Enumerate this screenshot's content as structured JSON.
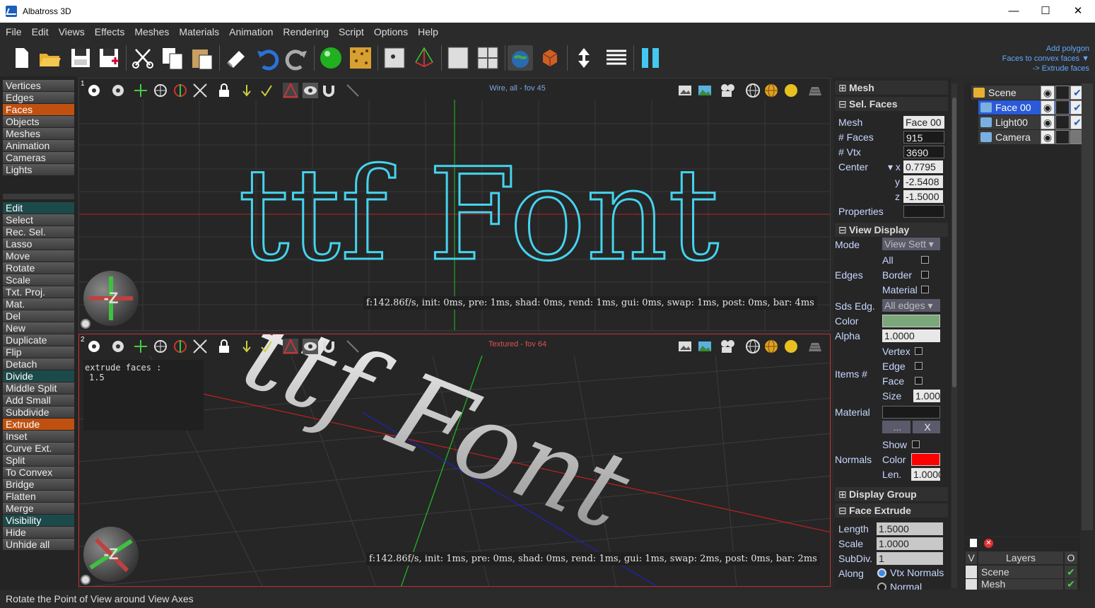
{
  "window": {
    "title": "Albatross 3D",
    "minimize": "—",
    "maximize": "☐",
    "close": "✕"
  },
  "menu": [
    "File",
    "Edit",
    "Views",
    "Effects",
    "Meshes",
    "Materials",
    "Animation",
    "Rendering",
    "Script",
    "Options",
    "Help"
  ],
  "hint": {
    "line1": "Add polygon",
    "line2": "Faces to convex faces ▼",
    "line3": "-> Extrude faces"
  },
  "modes": [
    "Vertices",
    "Edges",
    "Faces",
    "Objects",
    "Meshes",
    "Animation",
    "Cameras",
    "Lights"
  ],
  "selected_mode": "Faces",
  "tools": [
    {
      "label": "Edit",
      "kind": "head"
    },
    {
      "label": "Select"
    },
    {
      "label": "Rec. Sel."
    },
    {
      "label": "Lasso"
    },
    {
      "label": "Move"
    },
    {
      "label": "Rotate"
    },
    {
      "label": "Scale"
    },
    {
      "label": "Txt. Proj."
    },
    {
      "label": "Mat."
    },
    {
      "label": "Del"
    },
    {
      "label": "New"
    },
    {
      "label": "Duplicate"
    },
    {
      "label": "Flip"
    },
    {
      "label": "Detach"
    },
    {
      "label": "Divide",
      "kind": "head"
    },
    {
      "label": "Middle Split"
    },
    {
      "label": "Add Small"
    },
    {
      "label": "Subdivide"
    },
    {
      "label": "Extrude",
      "kind": "sel"
    },
    {
      "label": "Inset"
    },
    {
      "label": "Curve Ext."
    },
    {
      "label": "Split"
    },
    {
      "label": "To Convex"
    },
    {
      "label": "Bridge"
    },
    {
      "label": "Flatten"
    },
    {
      "label": "Merge"
    },
    {
      "label": "Visibility",
      "kind": "head"
    },
    {
      "label": "Hide"
    },
    {
      "label": "Unhide all"
    }
  ],
  "viewport1": {
    "number": "1",
    "title": "Wire, all - fov 45",
    "stats": "f:142.86f/s, init: 0ms, pre: 1ms, shad: 0ms, rend: 1ms, gui: 0ms, swap: 1ms, post: 0ms, bar: 4ms",
    "text": "ttf Font",
    "title_color": "#7aa7e0"
  },
  "viewport2": {
    "number": "2",
    "title": "Textured - fov 64",
    "stats": "f:142.86f/s, init: 1ms, pre: 0ms, shad: 0ms, rend: 1ms, gui: 1ms, swap: 2ms, post: 0ms, bar: 2ms",
    "text": "ttf Font",
    "console_line1": "extrude faces :",
    "console_line2": "1.5",
    "title_color": "#e05050"
  },
  "gizmo_label": "-Z",
  "props": {
    "mesh_head": "Mesh",
    "sel_faces_head": "Sel. Faces",
    "mesh_label": "Mesh",
    "mesh_value": "Face 00",
    "faces_label": "# Faces",
    "faces_value": "915",
    "vtx_label": "# Vtx",
    "vtx_value": "3690",
    "center_label": "Center",
    "cx_label": "▾ x",
    "cx": "0.7795",
    "cy_label": "y",
    "cy": "-2.5408",
    "cz_label": "z",
    "cz": "-1.5000",
    "properties_label": "Properties",
    "view_display_head": "View Display",
    "mode_label": "Mode",
    "mode_value": "View Sett ▾",
    "all_label": "All",
    "edges_label": "Edges",
    "border_label": "Border",
    "material_label": "Material",
    "sds_label": "Sds Edg.",
    "sds_value": "All edges ▾",
    "color_label": "Color",
    "color_value": "#7aa87a",
    "alpha_label": "Alpha",
    "alpha_value": "1.0000",
    "vertex_label": "Vertex",
    "items_label": "Items #",
    "edge_label": "Edge",
    "face_label": "Face",
    "size_label": "Size",
    "size_value": "1.000",
    "material2_label": "Material",
    "dots_label": "...",
    "x_label": "X",
    "show_label": "Show",
    "normals_label": "Normals",
    "ncolor_label": "Color",
    "ncolor_value": "#ff0000",
    "len_label": "Len.",
    "len_value": "1.0000",
    "display_group_head": "Display Group",
    "face_extrude_head": "Face Extrude",
    "length_label": "Length",
    "length_value": "1.5000",
    "scale_label": "Scale",
    "scale_value": "1.0000",
    "subdiv_label": "SubDiv.",
    "subdiv_value": "1",
    "along_label": "Along",
    "vtx_normals_label": "Vtx Normals",
    "normal_label": "Normal"
  },
  "scene": [
    {
      "label": "Scene",
      "level": 0,
      "icon": "folder-icon"
    },
    {
      "label": "Face 00",
      "level": 1,
      "icon": "mesh-icon",
      "selected": true
    },
    {
      "label": "Light00",
      "level": 1,
      "icon": "light-icon"
    },
    {
      "label": "Camera",
      "level": 1,
      "icon": "camera-icon"
    }
  ],
  "layers": {
    "v": "V",
    "header": "Layers",
    "o": "O",
    "rows": [
      "Scene",
      "Mesh"
    ]
  },
  "status": "Rotate the Point of View around View Axes"
}
